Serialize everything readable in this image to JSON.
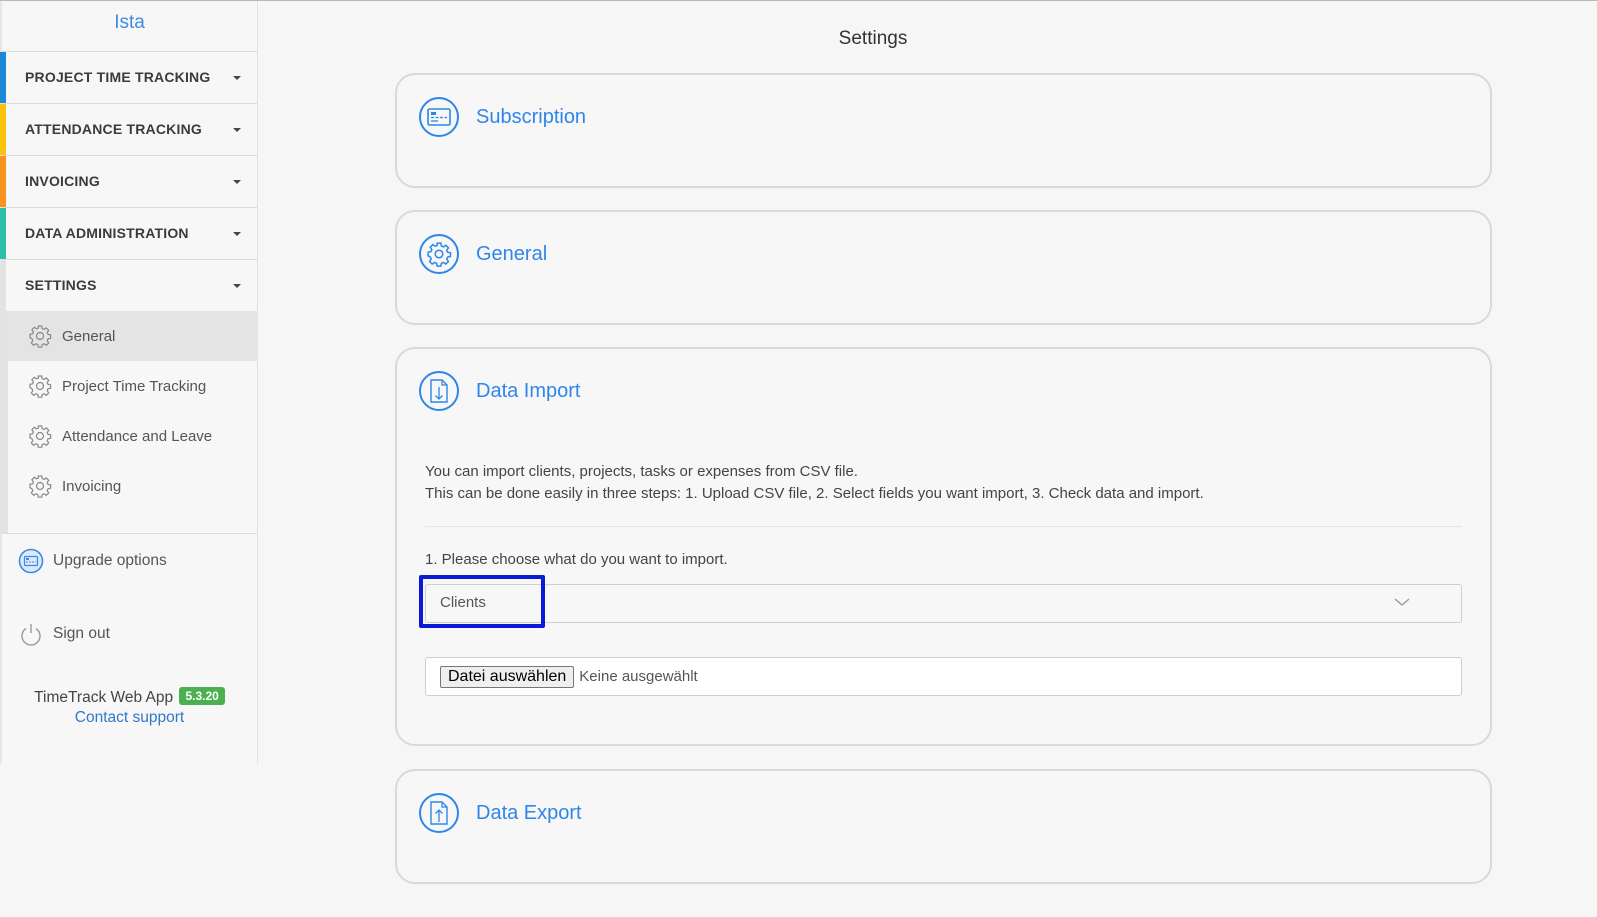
{
  "sidebar": {
    "brand": "Ista",
    "sections": [
      {
        "label": "PROJECT TIME TRACKING",
        "color": "#1e88d8"
      },
      {
        "label": "ATTENDANCE TRACKING",
        "color": "#fcc30b"
      },
      {
        "label": "INVOICING",
        "color": "#f7931e"
      },
      {
        "label": "DATA ADMINISTRATION",
        "color": "#2dbfa5"
      },
      {
        "label": "SETTINGS",
        "color": "#e3e3e3"
      }
    ],
    "settings_items": [
      {
        "label": "General",
        "icon": "gear-icon",
        "active": true
      },
      {
        "label": "Project Time Tracking",
        "icon": "gear-icon",
        "active": false
      },
      {
        "label": "Attendance and Leave",
        "icon": "gear-icon",
        "active": false
      },
      {
        "label": "Invoicing",
        "icon": "gear-icon",
        "active": false
      }
    ],
    "upgrade": {
      "label": "Upgrade options",
      "icon": "credit-card-icon"
    },
    "signout": {
      "label": "Sign out",
      "icon": "power-icon"
    },
    "app_name": "TimeTrack Web App",
    "version": "5.3.20",
    "support": "Contact support"
  },
  "main": {
    "title": "Settings",
    "cards": {
      "subscription": {
        "title": "Subscription",
        "icon": "credit-card-icon"
      },
      "general": {
        "title": "General",
        "icon": "gear-icon"
      },
      "import": {
        "title": "Data Import",
        "icon": "file-download-icon",
        "line1": "You can import clients, projects, tasks or expenses from CSV file.",
        "line2": "This can be done easily in three steps: 1. Upload CSV file, 2. Select fields you want import, 3. Check data and import.",
        "step1": "1. Please choose what do you want to import.",
        "select_value": "Clients",
        "file_button": "Datei auswählen",
        "file_status": "Keine ausgewählt"
      },
      "export": {
        "title": "Data Export",
        "icon": "file-upload-icon"
      }
    }
  },
  "colors": {
    "accent": "#2f86ea",
    "highlight": "#0a1bd8",
    "badge": "#4caf50"
  }
}
